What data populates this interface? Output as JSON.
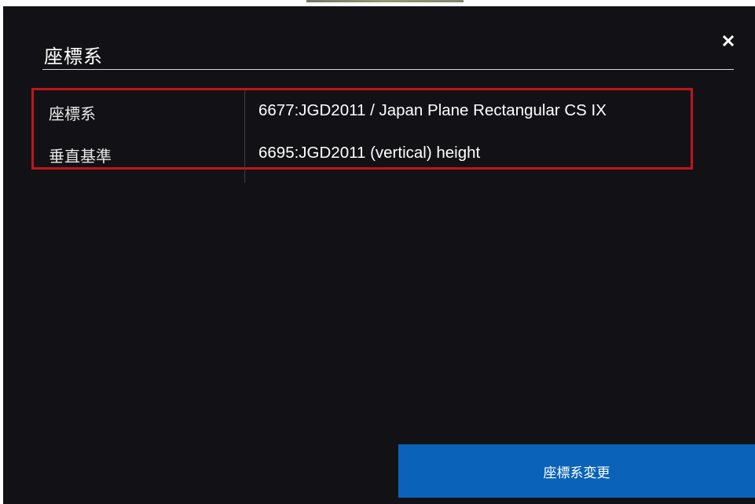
{
  "dialog": {
    "title": "座標系",
    "close_symbol": "×"
  },
  "info": {
    "rows": [
      {
        "label": "座標系",
        "value": "6677:JGD2011 / Japan Plane Rectangular CS IX"
      },
      {
        "label": "垂直基準",
        "value": "6695:JGD2011 (vertical) height"
      }
    ]
  },
  "actions": {
    "change_label": "座標系変更"
  },
  "colors": {
    "background": "#121216",
    "highlight_border": "#c0151a",
    "button": "#0a63b8",
    "text": "#ffffff"
  },
  "icons": {
    "close": "close-icon"
  }
}
